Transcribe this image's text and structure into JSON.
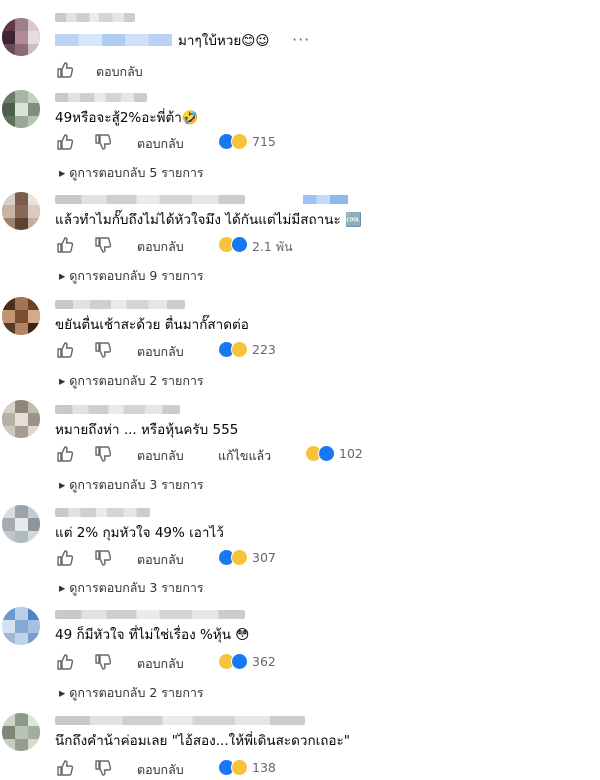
{
  "accent_color": "#1877f2",
  "reply_label": "ตอบกลับ",
  "edited_label": "แก้ไขแล้ว",
  "comments": [
    {
      "text": "มาๆใบ้หวย😊😉",
      "reaction_count": ""
    },
    {
      "text": "49หรือจะสู้2%อะพี่ต้า🤣",
      "reaction_count": "715",
      "view_replies": "ดูการตอบกลับ 5 รายการ"
    },
    {
      "text": "แล้วทำไมกั๊บถึงไม่ได้หัวใจมึง ได้กันแต่ไม่มีสถานะ 🆒",
      "reaction_count": "2.1 พัน",
      "view_replies": "ดูการตอบกลับ 9 รายการ"
    },
    {
      "text": "ขยันตื่นเช้าสะด้วย ตื่นมากั๊สาดต่อ",
      "reaction_count": "223",
      "view_replies": "ดูการตอบกลับ 2 รายการ"
    },
    {
      "text": "หมายถึงห่า ... หรือหุ้นครับ 555",
      "reaction_count": "102",
      "view_replies": "ดูการตอบกลับ 3 รายการ"
    },
    {
      "text": "แต่ 2% กุมหัวใจ 49% เอาไว้",
      "reaction_count": "307",
      "view_replies": "ดูการตอบกลับ 3 รายการ"
    },
    {
      "text": "49 ก็มีหัวใจ ที่ไม่ใช่เรื่อง %หุ้น 😳",
      "reaction_count": "362",
      "view_replies": "ดูการตอบกลับ 2 รายการ"
    },
    {
      "text": "นึกถึงคำน้าค่อมเลย \"ไอ้สอง...ให้พี่เดินสะดวกเถอะ\"",
      "reaction_count": "138"
    }
  ],
  "icons": {
    "like": "thumbs-up-icon",
    "dislike": "thumbs-down-icon",
    "more": "more-options-icon",
    "caret": "caret-right-icon"
  }
}
